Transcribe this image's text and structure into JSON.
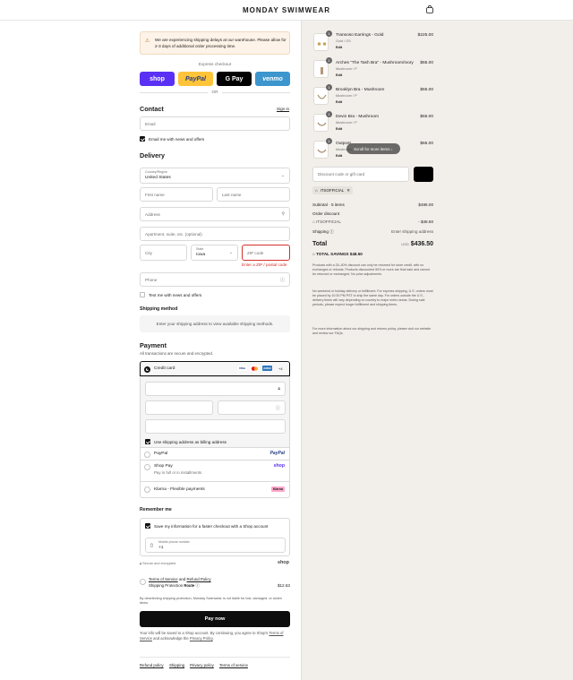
{
  "header": {
    "brand": "MONDAY SWIMWEAR",
    "cart_icon": "bag-icon"
  },
  "notice": {
    "text": "We are experiencing shipping delays at our warehouse. Please allow for 2-3 days of additional order processing time."
  },
  "express": {
    "label": "Express checkout",
    "buttons": [
      {
        "label": "shop",
        "color": "#5a31f4"
      },
      {
        "label": "PayPal",
        "color": "#ffc439"
      },
      {
        "label": "G Pay",
        "color": "#000000"
      },
      {
        "label": "venmo",
        "color": "#3d95ce"
      }
    ],
    "or": "OR"
  },
  "contact": {
    "title": "Contact",
    "sign_in": "Sign in",
    "email_placeholder": "Email",
    "email_news": "Email me with news and offers"
  },
  "delivery": {
    "title": "Delivery",
    "country_label": "Country/Region",
    "country_value": "United States",
    "first_name": "First name",
    "last_name": "Last name",
    "address": "Address",
    "apartment": "Apartment, suite, etc. (optional)",
    "city": "City",
    "state_label": "State",
    "state_value": "Iowa",
    "zip": "ZIP code",
    "zip_error": "Enter a ZIP / postal code",
    "phone": "Phone",
    "text_news": "Text me with news and offers"
  },
  "shipping_method": {
    "title": "Shipping method",
    "text": "Enter your shipping address to view available shipping methods."
  },
  "payment": {
    "title": "Payment",
    "subtitle": "All transactions are secure and encrypted.",
    "credit_card": "Credit card",
    "card_more": "+4",
    "billing_same": "Use shipping address as billing address",
    "paypal": "PayPal",
    "shop_pay": "Shop Pay",
    "shop_pay_sub": "Pay in full or in installments",
    "klarna": "Klarna - Flexible payments",
    "klarna_logo": "Klarna",
    "paypal_logo": "PayPal",
    "shop_logo": "shop"
  },
  "remember": {
    "title": "Remember me",
    "save_info": "Save my information for a faster checkout with a Shop account",
    "mobile_label": "Mobile phone number",
    "mobile_value": "+1",
    "secure": "Secure and encrypted",
    "shop_brand": "shop"
  },
  "protection": {
    "terms_text": "Terms of Service",
    "and": "and",
    "refund_text": "Refund Policy",
    "label": "Shipping Protection",
    "route": "Route",
    "price": "$12.63",
    "disclaimer": "By deselecting shipping protection, Monday Swimwear is not liable for lost, damaged, or stolen items."
  },
  "pay_now": "Pay now",
  "legal": {
    "prefix": "Your info will be saved to a Shop account. By continuing, you agree to Shop's",
    "tos": "Terms of Service",
    "middle": "and acknowledge the",
    "privacy": "Privacy Policy",
    "suffix": "."
  },
  "footer": [
    "Refund policy",
    "Shipping",
    "Privacy policy",
    "Terms of service"
  ],
  "cart": {
    "items": [
      {
        "qty": "1",
        "name": "Transoso Earrings - Gold",
        "variant": "Gold / OS",
        "edit": "Edit",
        "price": "$225.00"
      },
      {
        "qty": "1",
        "name": "Arches \"The Tash Bra\" - Mushroom/Ivory",
        "variant": "Mushroom / P",
        "edit": "Edit",
        "price": "$65.00"
      },
      {
        "qty": "1",
        "name": "Brooklyn Bra - Mushroom",
        "variant": "Mushroom / P",
        "edit": "Edit",
        "price": "$65.00"
      },
      {
        "qty": "1",
        "name": "Devin Bra - Mushroom",
        "variant": "Mushroom / P",
        "edit": "Edit",
        "price": "$65.00"
      },
      {
        "qty": "1",
        "name": "Outpost",
        "variant": "Mushroom",
        "edit": "Edit",
        "price": "$65.00"
      }
    ],
    "scroll_hint": "Scroll for more items",
    "discount_placeholder": "Discount code or gift card",
    "applied_code": "ITSOFFICIAL",
    "subtotal_label": "Subtotal · 5 items",
    "subtotal_value": "$486.00",
    "order_discount_label": "Order discount",
    "discount_code_label": "ITSOFFICIAL",
    "discount_value": "- $48.60",
    "shipping_label": "Shipping",
    "shipping_value": "Enter shipping address",
    "total_label": "Total",
    "currency": "USD",
    "total_value": "$436.50",
    "savings_label": "TOTAL SAVINGS",
    "savings_value": "$48.50",
    "policy_1": "Products with a 25–40% discount can only be returned for store credit, with no exchanges or refunds. Products discounted 50% or more are final sale and cannot be returned or exchanged. No price adjustments.",
    "policy_2": "No weekend or holiday delivery or fulfillment. For express shipping, U.S. orders must be placed by 10:30 PM PST to ship the same day. For orders outside the U.S., delivery times will vary depending on country to major metro areas. During sale periods, please expect longer fulfillment and shipping times.",
    "policy_3": "For more information about our shipping and returns policy, please visit our website and review our FAQs."
  }
}
